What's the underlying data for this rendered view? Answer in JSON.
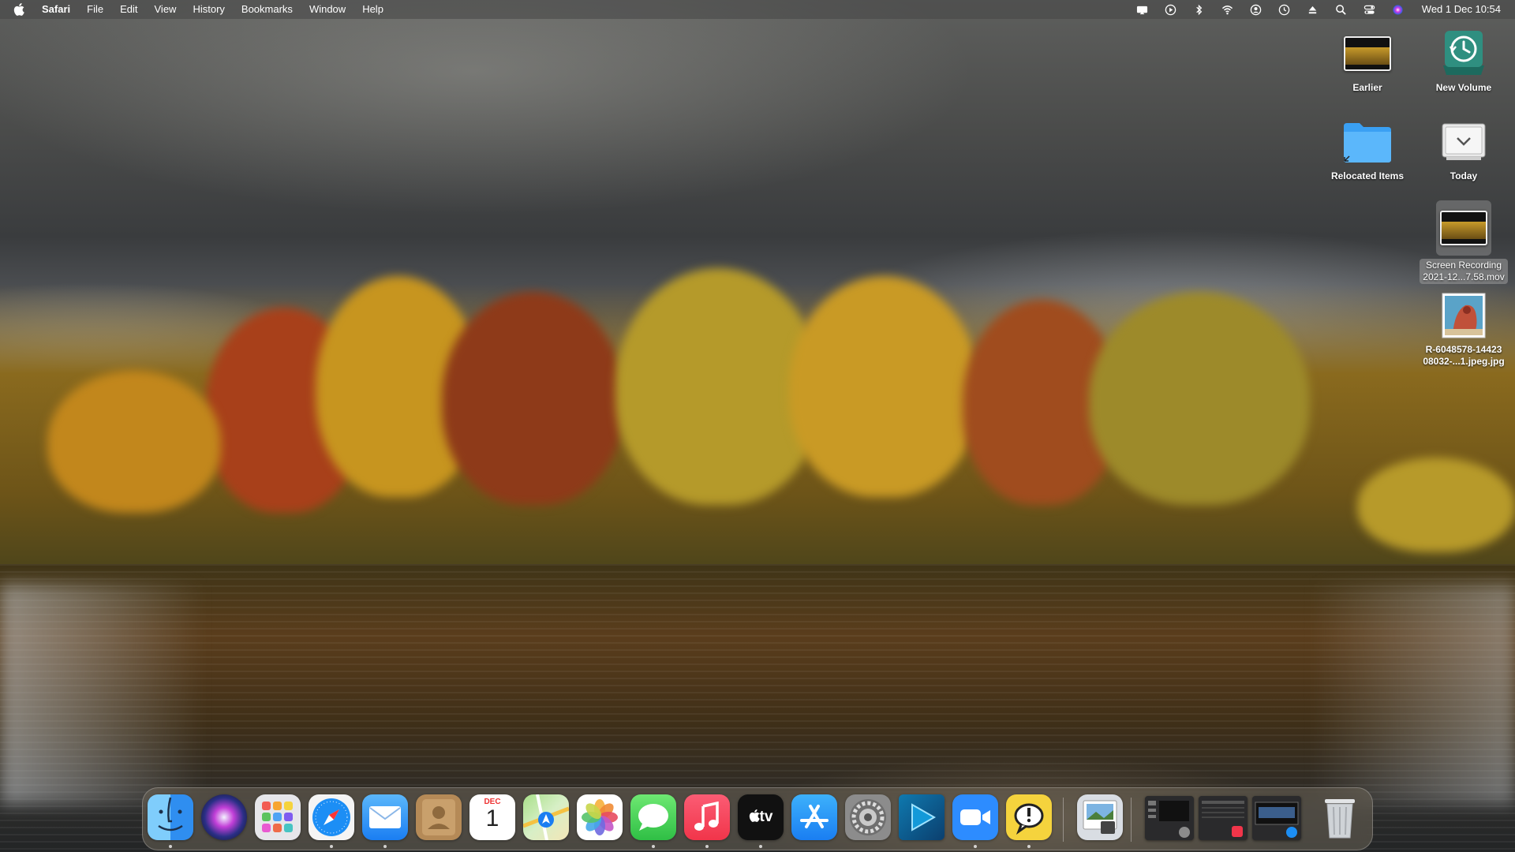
{
  "menubar": {
    "app_name": "Safari",
    "items": [
      "File",
      "Edit",
      "View",
      "History",
      "Bookmarks",
      "Window",
      "Help"
    ],
    "clock": "Wed 1 Dec  10:54",
    "status_icons": [
      "screen-mirroring-icon",
      "play-circle-icon",
      "bluetooth-icon",
      "wifi-icon",
      "user-circle-icon",
      "time-machine-icon",
      "eject-icon",
      "spotlight-search-icon",
      "control-center-icon",
      "siri-icon"
    ]
  },
  "desktop": {
    "icons": [
      {
        "label": "Earlier",
        "icon": "video-thumbnail"
      },
      {
        "label": "New Volume",
        "icon": "time-machine-drive"
      },
      {
        "label": "Relocated Items",
        "icon": "folder-alias"
      },
      {
        "label": "Today",
        "icon": "disk-image"
      },
      {
        "label_line1": "Screen Recording",
        "label_line2": "2021-12...7.58.mov",
        "icon": "video-thumbnail",
        "selected": true
      },
      {
        "label_line1": "R-6048578-14423",
        "label_line2": "08032-...1.jpeg.jpg",
        "icon": "image-thumbnail"
      }
    ]
  },
  "dock": {
    "apps": [
      "Finder",
      "Siri",
      "Launchpad",
      "Safari",
      "Mail",
      "Contacts",
      "Calendar",
      "Maps",
      "Photos",
      "Messages",
      "Music",
      "TV",
      "App Store",
      "System Preferences",
      "Prime Video",
      "Zoom",
      "Quick Answers"
    ],
    "calendar_month": "DEC",
    "calendar_day": "1",
    "tv_label": "tv",
    "extras": [
      "Preview",
      "Minimized window 1",
      "Minimized window 2",
      "Minimized window 3",
      "Trash"
    ]
  },
  "colors": {
    "finder_blue": "#3aa0f3",
    "safari_blue": "#1c8ef5",
    "messages_green": "#4cd964",
    "music_red": "#f94154",
    "zoom_blue": "#2d8cff",
    "app_store_blue": "#1a8cf6"
  }
}
